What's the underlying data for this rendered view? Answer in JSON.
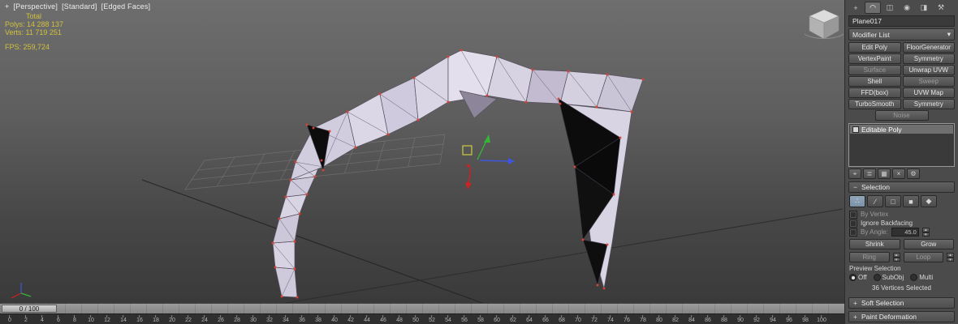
{
  "viewport": {
    "label_plus": "+",
    "label_perspective": "[Perspective]",
    "label_standard": "[Standard]",
    "label_edged_faces": "[Edged Faces]",
    "stats": {
      "total": "Total",
      "polys": "Polys: 14 288 137",
      "verts": "Verts: 11 719 251",
      "fps": "FPS: 259,724"
    }
  },
  "timeline": {
    "slider_label": "0 / 100",
    "ticks": [
      "0",
      "2",
      "4",
      "6",
      "8",
      "10",
      "12",
      "14",
      "16",
      "18",
      "20",
      "22",
      "24",
      "26",
      "28",
      "30",
      "32",
      "34",
      "36",
      "38",
      "40",
      "42",
      "44",
      "46",
      "48",
      "50",
      "52",
      "54",
      "56",
      "58",
      "60",
      "62",
      "64",
      "66",
      "68",
      "70",
      "72",
      "74",
      "76",
      "78",
      "80",
      "82",
      "84",
      "86",
      "88",
      "90",
      "92",
      "94",
      "96",
      "98",
      "100"
    ]
  },
  "command_panel": {
    "tabs": [
      {
        "name": "create",
        "glyph": "+"
      },
      {
        "name": "modify",
        "glyph": "◠"
      },
      {
        "name": "hierarchy",
        "glyph": "◫"
      },
      {
        "name": "motion",
        "glyph": "◉"
      },
      {
        "name": "display",
        "glyph": "◨"
      },
      {
        "name": "utilities",
        "glyph": "⚒"
      }
    ],
    "object_name": "Plane017",
    "modifier_list_label": "Modifier List",
    "dropdown_arrow": "▾",
    "modifier_buttons": [
      "Edit Poly",
      "FloorGenerator",
      "VertexPaint",
      "Symmetry",
      "Surface",
      "Unwrap UVW",
      "Shell",
      "Sweep",
      "FFD(box)",
      "UVW Map",
      "TurboSmooth",
      "Symmetry",
      "Noise"
    ],
    "stack_items": [
      {
        "label": "Editable Poly"
      }
    ],
    "stack_tools": [
      {
        "name": "pin-stack",
        "glyph": "⌖"
      },
      {
        "name": "show-end-result",
        "glyph": "≣"
      },
      {
        "name": "make-unique",
        "glyph": "▦"
      },
      {
        "name": "remove-modifier",
        "glyph": "×"
      },
      {
        "name": "configure-modifier-sets",
        "glyph": "⚙"
      }
    ],
    "rollouts": {
      "selection": {
        "marker": "−",
        "title": "Selection"
      },
      "soft_selection": {
        "marker": "+",
        "title": "Soft Selection"
      },
      "paint_deformation": {
        "marker": "+",
        "title": "Paint Deformation"
      }
    },
    "subobject_buttons": [
      {
        "name": "vertex",
        "glyph": "∴"
      },
      {
        "name": "edge",
        "glyph": "∕"
      },
      {
        "name": "border",
        "glyph": "□"
      },
      {
        "name": "polygon",
        "glyph": "■"
      },
      {
        "name": "element",
        "glyph": "◆"
      }
    ],
    "selection": {
      "by_vertex": "By Vertex",
      "ignore_backfacing": "Ignore Backfacing",
      "by_angle": "By Angle:",
      "by_angle_value": "45.0",
      "shrink": "Shrink",
      "grow": "Grow",
      "ring": "Ring",
      "loop": "Loop",
      "preview_selection": "Preview Selection",
      "off": "Off",
      "subobj": "SubObj",
      "multi": "Multi",
      "status": "36 Vertices Selected",
      "spinner_up": "▴",
      "spinner_down": "▾"
    }
  },
  "colors": {
    "viewport_top": "#6e6e6e",
    "viewport_bottom": "#3a3a3a",
    "mesh_light": "#d6d1e0",
    "mesh_backface": "#0c0c0c",
    "vertex_dot": "#dc4234",
    "gizmo_red": "#cf2222",
    "gizmo_green": "#35b535",
    "gizmo_blue": "#4055dd",
    "gizmo_plane_yellow": "#d6d640",
    "stats_text": "#d2c13c",
    "panel_bg": "#4b4b4b",
    "subobject_active": "#7b91a6"
  }
}
